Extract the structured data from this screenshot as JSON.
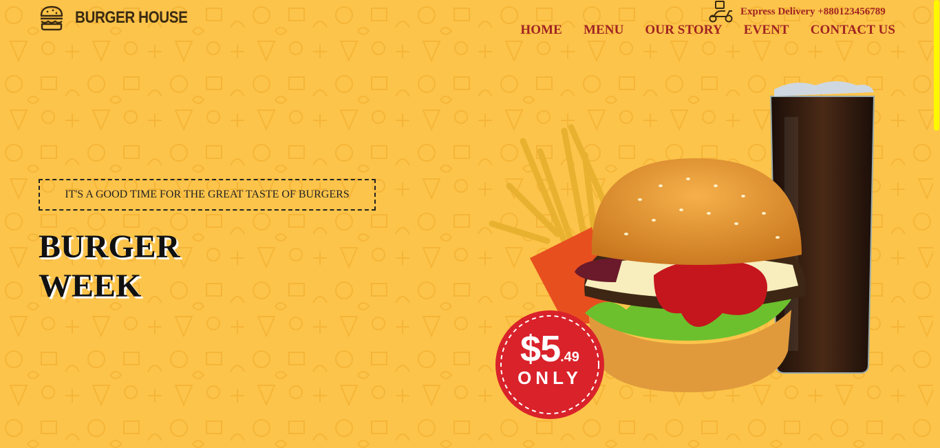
{
  "brand": {
    "name": "BURGER HOUSE"
  },
  "delivery": {
    "text": "Express Delivery +880123456789"
  },
  "nav": {
    "items": [
      "HOME",
      "MENU",
      "OUR STORY",
      "EVENT",
      "CONTACT US"
    ]
  },
  "hero": {
    "tagline": "IT'S A GOOD TIME FOR THE GREAT TASTE OF BURGERS",
    "headline_line1": "BURGER",
    "headline_line2": "WEEK"
  },
  "price": {
    "main": "$5",
    "cents": ".49",
    "suffix": "ONLY"
  },
  "colors": {
    "background": "#fcc44a",
    "nav_text": "#a02322",
    "badge": "#d9222a",
    "scrollbar": "#fff700"
  },
  "icons": [
    "burger-logo-icon",
    "delivery-scooter-icon"
  ]
}
